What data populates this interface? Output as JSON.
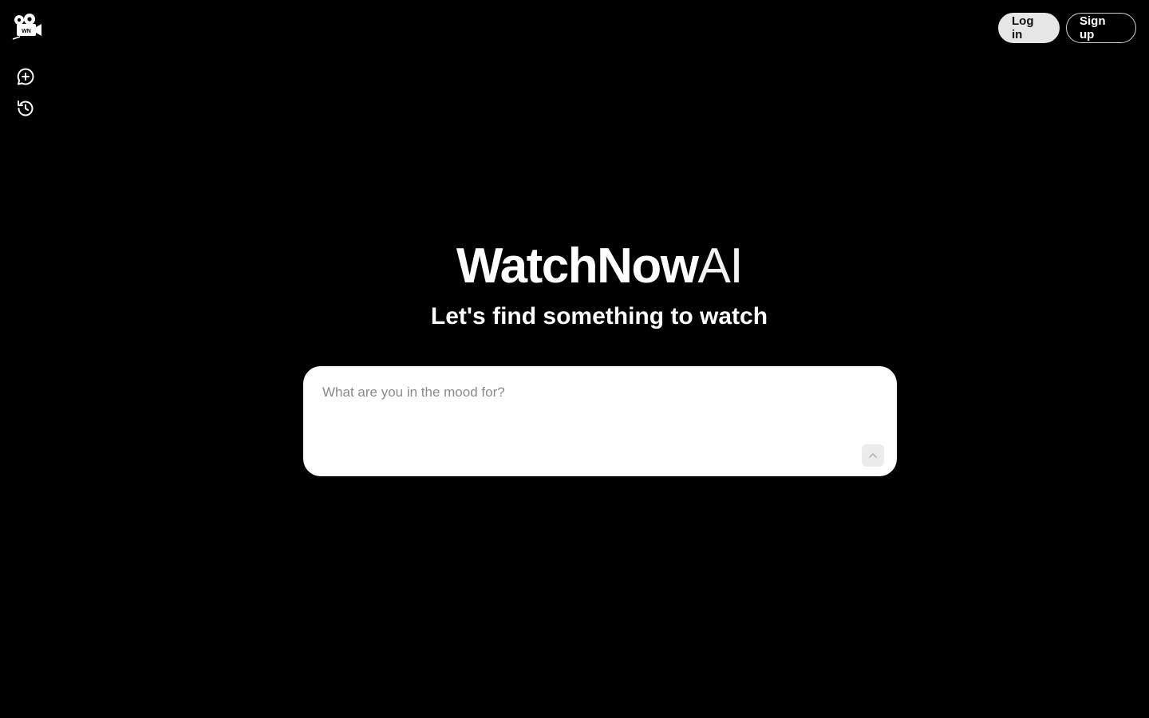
{
  "app": {
    "logo_text": "WN"
  },
  "rail": {
    "items": [
      {
        "icon": "new-chat-icon"
      },
      {
        "icon": "history-icon"
      }
    ]
  },
  "header": {
    "login_label": "Log in",
    "signup_label": "Sign up"
  },
  "hero": {
    "brand_bold": "WatchNow",
    "brand_thin": "AI",
    "tagline": "Let's find something to watch"
  },
  "prompt": {
    "value": "",
    "placeholder": "What are you in the mood for?",
    "send_icon": "arrow-up-icon"
  },
  "colors": {
    "background": "#000000",
    "foreground": "#ffffff",
    "login_bg": "#e6e6e6",
    "send_bg": "#ececec"
  }
}
